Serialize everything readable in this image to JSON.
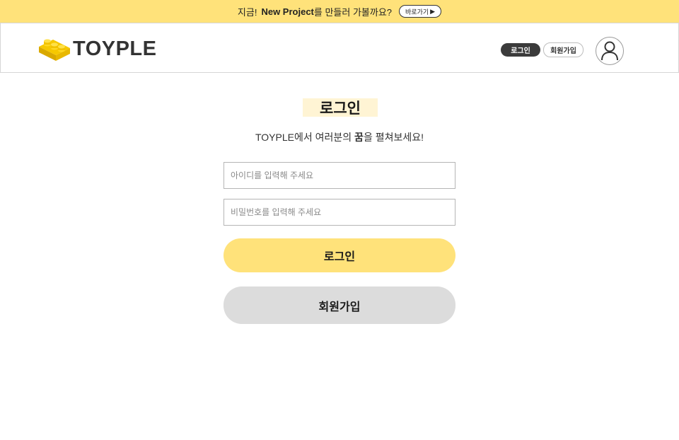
{
  "banner": {
    "prefix": "지금!",
    "highlight": "New Project",
    "suffix": "를 만들러 가볼까요?",
    "button_label": "바로가기",
    "button_arrow": "▶"
  },
  "header": {
    "logo_text": "TOYPLE",
    "logo_icon": "lego-brick-icon",
    "login_label": "로그인",
    "signup_label": "회원가입",
    "avatar_icon": "user-icon"
  },
  "main": {
    "title": "로그인",
    "subtitle_prefix": "TOYPLE에서 여러분의 ",
    "subtitle_bold": "꿈",
    "subtitle_suffix": "을 펼쳐보세요!",
    "id_placeholder": "아이디를 입력해 주세요",
    "id_value": "",
    "pw_placeholder": "비밀번호를 입력해 주세요",
    "pw_value": "",
    "login_button": "로그인",
    "signup_button": "회원가입"
  },
  "colors": {
    "accent": "#ffe27a",
    "title_highlight": "#fff4d4",
    "dark_button": "#3b3b3b",
    "secondary_button": "#dcdcdc"
  }
}
